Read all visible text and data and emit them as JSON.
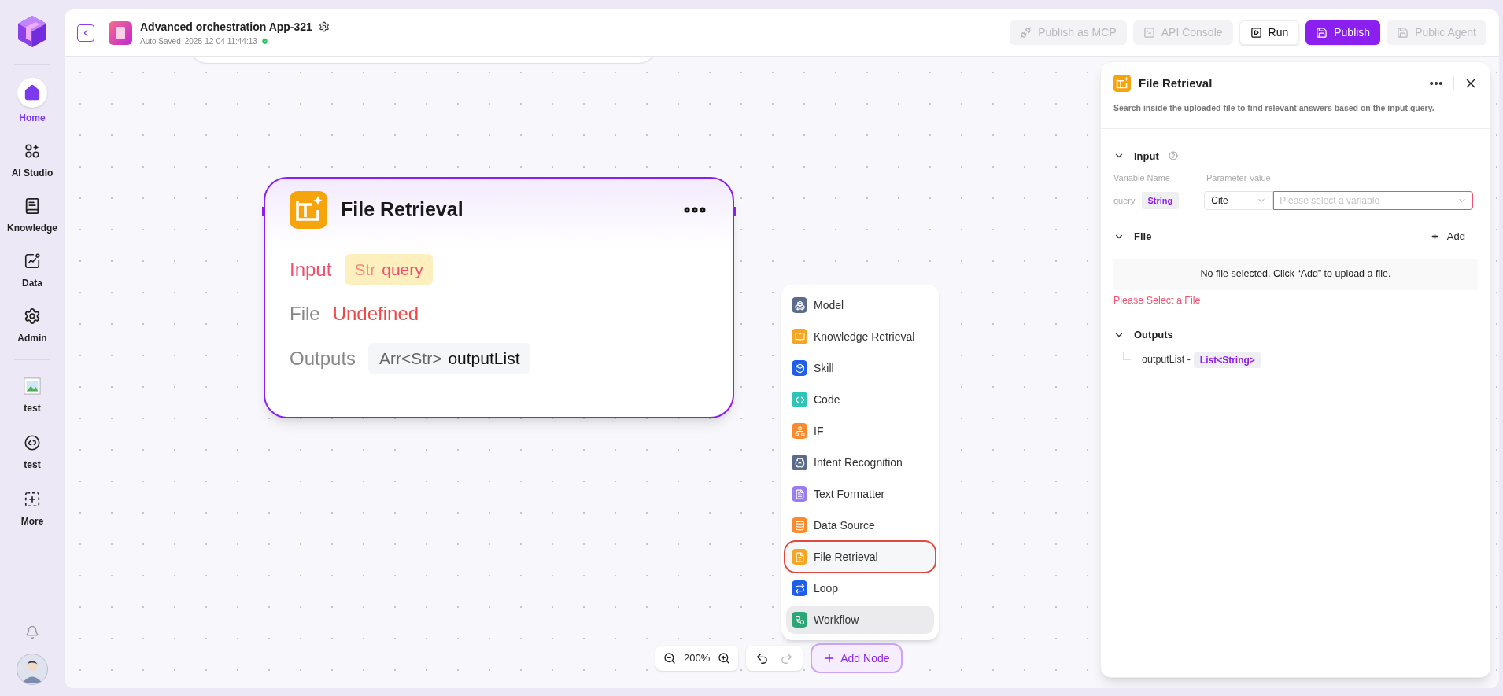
{
  "sidebar": {
    "items": [
      {
        "label": "Home",
        "selected": true
      },
      {
        "label": "AI Studio",
        "selected": false
      },
      {
        "label": "Knowledge",
        "selected": false
      },
      {
        "label": "Data",
        "selected": false
      },
      {
        "label": "Admin",
        "selected": false
      },
      {
        "label": "test",
        "selected": false
      },
      {
        "label": "test",
        "selected": false
      },
      {
        "label": "More",
        "selected": false
      }
    ]
  },
  "header": {
    "app_name": "Advanced orchestration App-321",
    "save_status": "Auto Saved",
    "saved_at": "2025-12-04 11:44:13",
    "buttons": [
      {
        "label": "Publish as MCP",
        "kind": "default",
        "disabled": true
      },
      {
        "label": "API Console",
        "kind": "default",
        "disabled": true
      },
      {
        "label": "Run",
        "kind": "default",
        "disabled": false
      },
      {
        "label": "Publish",
        "kind": "primary",
        "disabled": false
      },
      {
        "label": "Public Agent",
        "kind": "default",
        "disabled": true
      }
    ]
  },
  "node": {
    "title": "File Retrieval",
    "input_label": "Input",
    "input_type": "Str",
    "input_name": "query",
    "file_label": "File",
    "file_value": "Undefined",
    "outputs_label": "Outputs",
    "output_type": "Arr<Str>",
    "output_name": "outputList"
  },
  "node_menu": {
    "items": [
      {
        "label": "Model",
        "color": "#5b6b8c",
        "selected": false,
        "hovered": false
      },
      {
        "label": "Knowledge Retrieval",
        "color": "#f5a524",
        "selected": false,
        "hovered": false
      },
      {
        "label": "Skill",
        "color": "#1f5eea",
        "selected": false,
        "hovered": false
      },
      {
        "label": "Code",
        "color": "#2ec4b6",
        "selected": false,
        "hovered": false
      },
      {
        "label": "IF",
        "color": "#fb8a2e",
        "selected": false,
        "hovered": false
      },
      {
        "label": "Intent Recognition",
        "color": "#5b6b8c",
        "selected": false,
        "hovered": false
      },
      {
        "label": "Text Formatter",
        "color": "#9b7cf0",
        "selected": false,
        "hovered": false
      },
      {
        "label": "Data Source",
        "color": "#fb8a2e",
        "selected": false,
        "hovered": false
      },
      {
        "label": "File Retrieval",
        "color": "#f5a524",
        "selected": true,
        "hovered": false
      },
      {
        "label": "Loop",
        "color": "#1f5eea",
        "selected": false,
        "hovered": false
      },
      {
        "label": "Workflow",
        "color": "#2ba777",
        "selected": false,
        "hovered": true
      }
    ]
  },
  "toolbar": {
    "zoom": "200%",
    "redo_disabled": true,
    "add_node": "Add Node"
  },
  "panel": {
    "title": "File Retrieval",
    "description": "Search inside the uploaded file to find relevant answers based on the input query.",
    "input": {
      "title": "Input",
      "expanded": true,
      "variable_name_header": "Variable Name",
      "parameter_value_header": "Parameter Value",
      "variable": "query",
      "type": "String",
      "mode": "Cite",
      "placeholder": "Please select a variable"
    },
    "file": {
      "title": "File",
      "expanded": true,
      "add": "Add",
      "empty": "No file selected. Click “Add” to upload a file.",
      "error": "Please Select a File"
    },
    "outputs": {
      "title": "Outputs",
      "expanded": true,
      "name": "outputList -",
      "type": "List<String>"
    }
  }
}
